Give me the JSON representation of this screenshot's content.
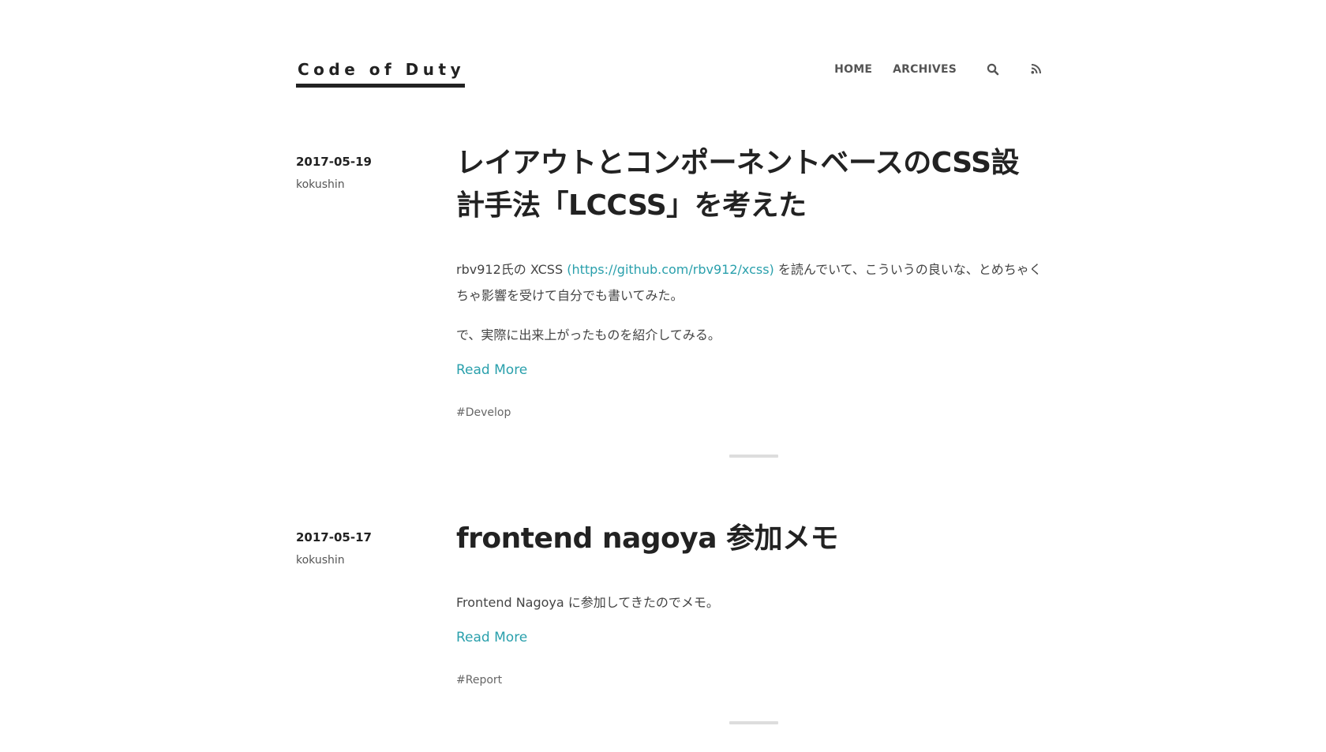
{
  "site": {
    "title": "Code of Duty"
  },
  "nav": {
    "items": [
      {
        "label": "HOME"
      },
      {
        "label": "ARCHIVES"
      }
    ],
    "icons": [
      "search-icon",
      "rss-icon"
    ]
  },
  "posts": [
    {
      "date": "2017-05-19",
      "author": "kokushin",
      "title": "レイアウトとコンポーネントベースのCSS設計手法「LCCSS」を考えた",
      "excerpt": {
        "p1_before_link": "rbv912氏の XCSS ",
        "p1_link": "(https://github.com/rbv912/xcss)",
        "p1_after_link": " を読んでいて、こういうの良いな、とめちゃくちゃ影響を受けて自分でも書いてみた。",
        "p2": "で、実際に出来上がったものを紹介してみる。"
      },
      "read_more": "Read More",
      "tag": "#Develop"
    },
    {
      "date": "2017-05-17",
      "author": "kokushin",
      "title": "frontend nagoya 参加メモ",
      "excerpt": {
        "p1": "Frontend Nagoya に参加してきたのでメモ。"
      },
      "read_more": "Read More",
      "tag": "#Report"
    }
  ],
  "colors": {
    "link": "#2aa0ac",
    "text": "#444444",
    "heading": "#222222",
    "divider": "#dddddd"
  }
}
